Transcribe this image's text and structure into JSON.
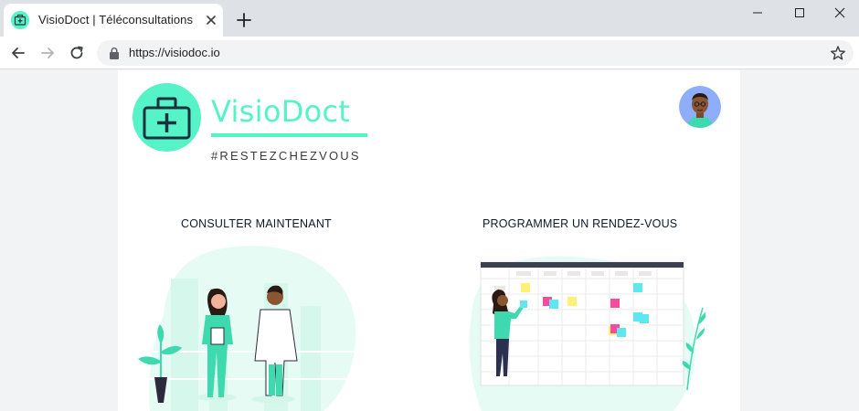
{
  "browser": {
    "tab_title": "VisioDoct | Téléconsultations",
    "url": "https://visiodoc.io",
    "icons": {
      "favicon": "medical-kit-icon",
      "close": "close-icon",
      "new_tab": "plus-icon",
      "back": "arrow-left-icon",
      "forward": "arrow-right-icon",
      "reload": "reload-icon",
      "lock": "lock-icon",
      "bookmark": "star-icon",
      "minimize": "minimize-icon",
      "maximize": "maximize-icon",
      "window_close": "close-icon"
    }
  },
  "header": {
    "brand": "VisioDoct",
    "tagline": "#RESTEZCHEZVOUS",
    "brand_color": "#56f2c8"
  },
  "options": {
    "consult": {
      "label": "CONSULTER MAINTENANT"
    },
    "appointment": {
      "label": "PROGRAMMER UN RENDEZ-VOUS"
    }
  },
  "colors": {
    "accent": "#56f2c8",
    "sticky_yellow": "#fff176",
    "sticky_pink": "#f54c9b",
    "sticky_cyan": "#5de8f0",
    "text_dark": "#0d1b2a"
  }
}
